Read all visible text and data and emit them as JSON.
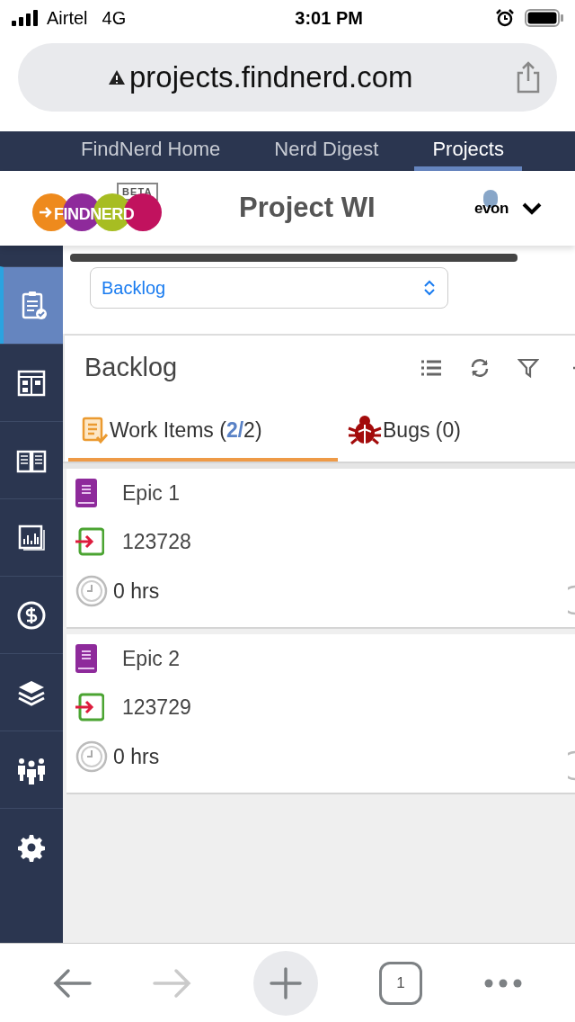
{
  "status_bar": {
    "carrier": "Airtel",
    "network": "4G",
    "time": "3:01 PM"
  },
  "browser": {
    "url": "projects.findnerd.com",
    "tab_count": "1",
    "forward_disabled": true
  },
  "top_nav": [
    {
      "label": "FindNerd Home",
      "selected": false
    },
    {
      "label": "Nerd Digest",
      "selected": false
    },
    {
      "label": "Projects",
      "selected": true
    }
  ],
  "header": {
    "logo_text": "FINDNERD",
    "badge": "BETA",
    "title": "Project WI",
    "company_logo": "evon"
  },
  "sidebar": [
    {
      "kind": "clipboard",
      "selected": true
    },
    {
      "kind": "board",
      "selected": false
    },
    {
      "kind": "book",
      "selected": false
    },
    {
      "kind": "chart",
      "selected": false
    },
    {
      "kind": "dollar",
      "selected": false
    },
    {
      "kind": "layers",
      "selected": false
    },
    {
      "kind": "team",
      "selected": false
    },
    {
      "kind": "gear",
      "selected": false
    }
  ],
  "view_select": {
    "value": "Backlog"
  },
  "panel": {
    "title": "Backlog"
  },
  "tabs": [
    {
      "kind": "work",
      "label": "Work Items (",
      "highlight": "2/",
      "rest": "2)",
      "selected": true
    },
    {
      "kind": "bugs",
      "label": "Bugs (0)",
      "selected": false
    }
  ],
  "items": [
    {
      "title": "Epic 1",
      "id": "123728",
      "hours": "0 hrs"
    },
    {
      "title": "Epic 2",
      "id": "123729",
      "hours": "0 hrs"
    }
  ]
}
